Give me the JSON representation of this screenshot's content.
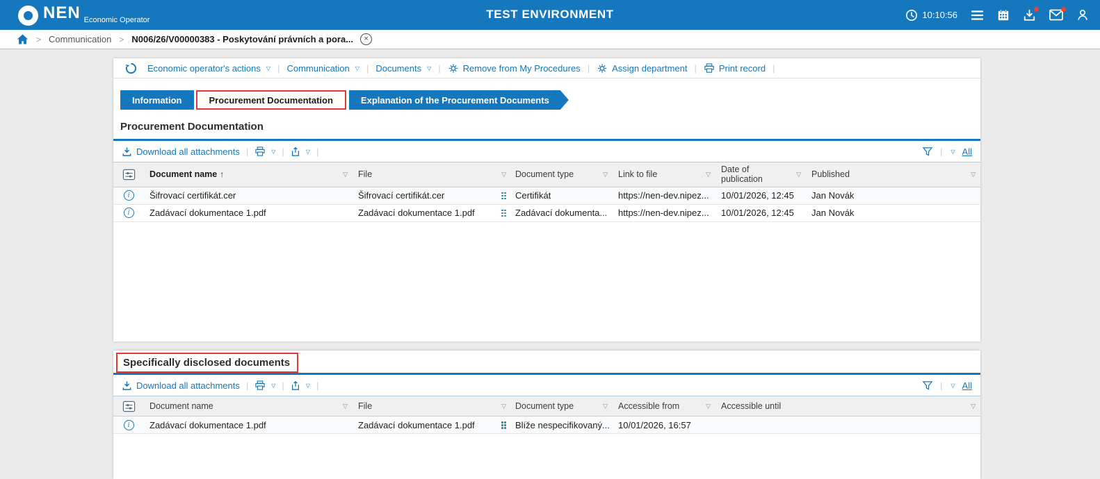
{
  "colors": {
    "accent": "#1577bd",
    "highlight_red": "#e03b30"
  },
  "appbar": {
    "logo": "NEN",
    "logo_sub": "Economic Operator",
    "title": "TEST ENVIRONMENT",
    "time": "10:10:56"
  },
  "breadcrumb": {
    "link": "Communication",
    "current": "N006/26/V00000383 - Poskytování právních a pora..."
  },
  "toolbar": {
    "menu1": "Economic operator's actions",
    "menu2": "Communication",
    "menu3": "Documents",
    "action1": "Remove from My Procedures",
    "action2": "Assign department",
    "action3": "Print record"
  },
  "tabs": {
    "tab1": "Information",
    "tab2": "Procurement Documentation",
    "tab3": "Explanation of the Procurement Documents"
  },
  "section1": {
    "title": "Procurement Documentation",
    "download_all": "Download all attachments",
    "all": "All",
    "sort_arrow": "↑",
    "columns": {
      "name": "Document name",
      "file": "File",
      "type": "Document type",
      "link": "Link to file",
      "date": "Date of publication",
      "published": "Published"
    },
    "rows": [
      {
        "name": "Šifrovací certifikát.cer",
        "file": "Šifrovací certifikát.cer",
        "type": "Certifikát",
        "link": "https://nen-dev.nipez...",
        "date": "10/01/2026, 12:45",
        "published": "Jan Novák"
      },
      {
        "name": "Zadávací dokumentace 1.pdf",
        "file": "Zadávací dokumentace 1.pdf",
        "type": "Zadávací dokumenta...",
        "link": "https://nen-dev.nipez...",
        "date": "10/01/2026, 12:45",
        "published": "Jan Novák"
      }
    ]
  },
  "section2": {
    "title": "Specifically disclosed documents",
    "download_all": "Download all attachments",
    "all": "All",
    "columns": {
      "name": "Document name",
      "file": "File",
      "type": "Document type",
      "from": "Accessible from",
      "until": "Accessible until"
    },
    "rows": [
      {
        "name": "Zadávací dokumentace 1.pdf",
        "file": "Zadávací dokumentace 1.pdf",
        "type": "Blíže nespecifikovaný...",
        "from": "10/01/2026, 16:57",
        "until": ""
      }
    ]
  }
}
